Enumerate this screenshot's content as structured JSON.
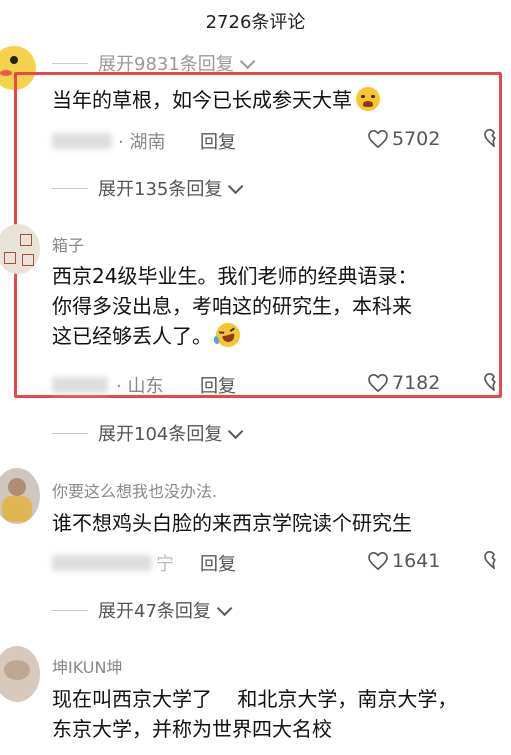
{
  "header": {
    "title": "2726条评论"
  },
  "comments": [
    {
      "expand_top": "展开9831条回复",
      "text": "当年的草根，如今已长成参天大草",
      "location": "· 湖南",
      "reply": "回复",
      "likes": "5702",
      "expand": "展开135条回复"
    },
    {
      "username": "箱子",
      "line1": "西京24级毕业生。我们老师的经典语录：",
      "line2": "你得多没出息，考咱这的研究生，本科来",
      "line3": "这已经够丢人了。",
      "location": "· 山东",
      "reply": "回复",
      "likes": "7182",
      "expand": "展开104条回复"
    },
    {
      "username": "你要这么想我也没办法.",
      "text": "谁不想鸡头白脸的来西京学院读个研究生",
      "location": "宁",
      "reply": "回复",
      "likes": "1641",
      "expand": "展开47条回复"
    },
    {
      "username": "坤IKUN坤",
      "line1": "现在叫西京大学了    和北京大学，南京大学，",
      "line2": "东京大学，并称为世界四大名校"
    }
  ],
  "colors": {
    "highlight": "#e8474b",
    "avatar_cartoon": "#f5d24a"
  }
}
